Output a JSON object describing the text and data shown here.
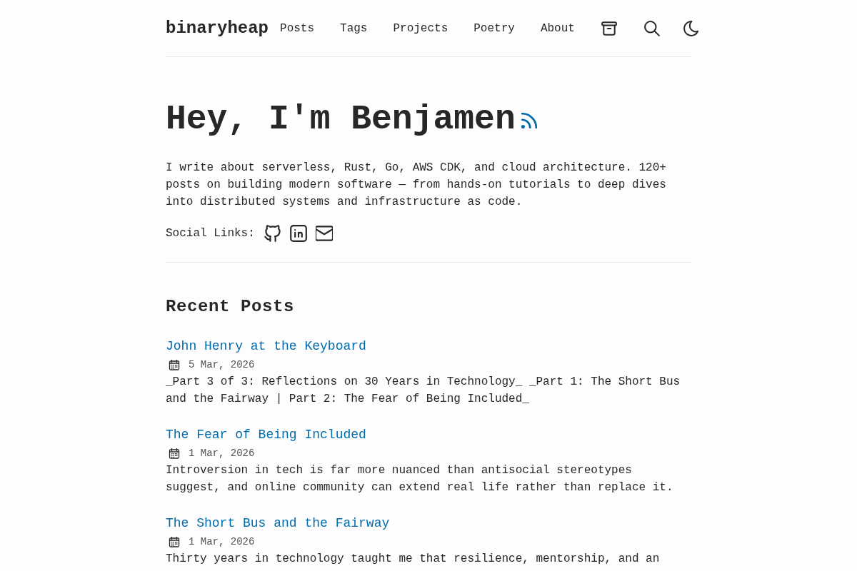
{
  "header": {
    "logo": "binaryheap",
    "nav": [
      {
        "label": "Posts",
        "selected": false
      },
      {
        "label": "Tags",
        "selected": false
      },
      {
        "label": "Projects",
        "selected": false
      },
      {
        "label": "Poetry",
        "selected": false
      },
      {
        "label": "About",
        "selected": false
      }
    ]
  },
  "hero": {
    "title": "Hey, I'm Benjamen",
    "intro": "I write about serverless, Rust, Go, AWS CDK, and cloud architecture. 120+ posts on building modern software — from hands-on tutorials to deep dives into distributed systems and infrastructure as code.",
    "social_label": "Social Links:"
  },
  "recent_posts": {
    "heading": "Recent Posts",
    "posts": [
      {
        "title": "John Henry at the Keyboard",
        "date": "5 Mar, 2026",
        "description": "_Part 3 of 3: Reflections on 30 Years in Technology_ _Part 1: The Short Bus and the Fairway | Part 2: The Fear of Being Included_"
      },
      {
        "title": "The Fear of Being Included",
        "date": "1 Mar, 2026",
        "description": "Introversion in tech is far more nuanced than antisocial stereotypes suggest, and online community can extend real life rather than replace it."
      },
      {
        "title": "The Short Bus and the Fairway",
        "date": "1 Mar, 2026",
        "description": "Thirty years in technology taught me that resilience, mentorship, and an"
      }
    ]
  }
}
